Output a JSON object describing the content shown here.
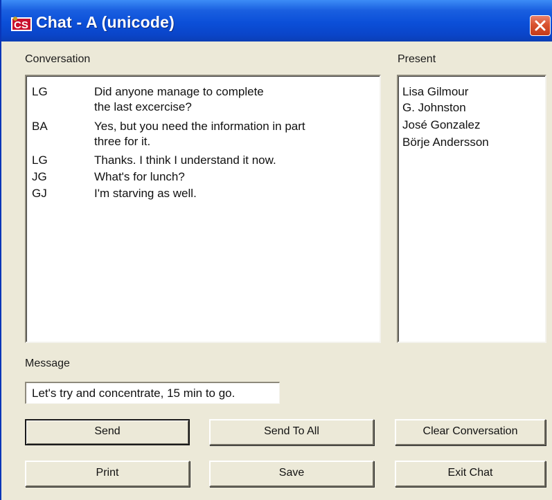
{
  "window": {
    "title": "Chat - A (unicode)",
    "icon": "app-chat-icon",
    "close_icon": "close-icon"
  },
  "conversation": {
    "label": "Conversation",
    "lines": [
      {
        "who": "LG",
        "text": "Did anyone manage to complete"
      },
      {
        "who": "",
        "text": "the last excercise?"
      },
      {
        "who": "BA",
        "text": "Yes, but you need the information in part"
      },
      {
        "who": "",
        "text": "three for it."
      },
      {
        "who": "LG",
        "text": "Thanks. I think I understand it now."
      },
      {
        "who": "JG",
        "text": "What's for lunch?"
      },
      {
        "who": "GJ",
        "text": "I'm starving as well."
      }
    ]
  },
  "present": {
    "label": "Present",
    "users": [
      "Lisa Gilmour",
      "G. Johnston",
      "José Gonzalez",
      "Börje Andersson"
    ]
  },
  "message": {
    "label": "Message",
    "value": "Let's try and concentrate, 15 min to go."
  },
  "buttons": {
    "send": "Send",
    "send_to_all": "Send To All",
    "clear_conversation": "Clear Conversation",
    "print": "Print",
    "save": "Save",
    "exit_chat": "Exit Chat"
  },
  "colors": {
    "titlebar": "#0b4fd8",
    "close": "#d9532f",
    "face": "#ece9d8"
  }
}
